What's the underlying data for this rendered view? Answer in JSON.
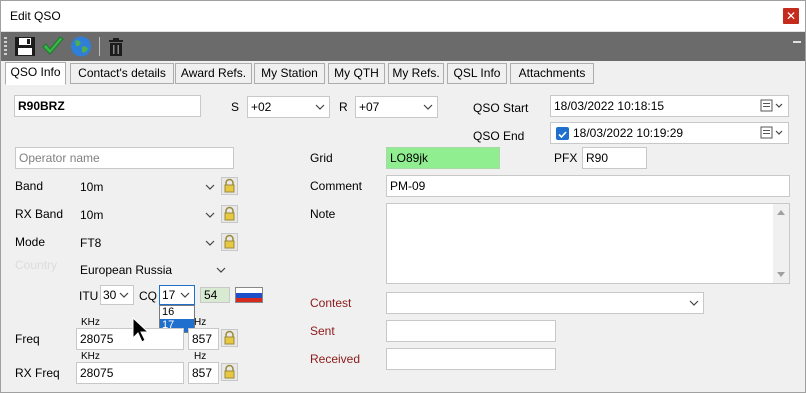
{
  "window": {
    "title": "Edit QSO"
  },
  "toolbar": {
    "icons": [
      "save-icon",
      "check-icon",
      "globe-icon",
      "trash-icon"
    ]
  },
  "tabs": [
    {
      "label": "QSO Info",
      "active": true
    },
    {
      "label": "Contact's details"
    },
    {
      "label": "Award Refs."
    },
    {
      "label": "My Station"
    },
    {
      "label": "My QTH"
    },
    {
      "label": "My Refs."
    },
    {
      "label": "QSL Info"
    },
    {
      "label": "Attachments"
    }
  ],
  "form": {
    "callsign": "R90BRZ",
    "s_label": "S",
    "s_value": "+02",
    "r_label": "R",
    "r_value": "+07",
    "qso_start_label": "QSO Start",
    "qso_start_value": "18/03/2022 10:18:15",
    "qso_end_label": "QSO End",
    "qso_end_value": "18/03/2022 10:19:29",
    "operator_placeholder": "Operator name",
    "band_label": "Band",
    "band_value": "10m",
    "rx_band_label": "RX Band",
    "rx_band_value": "10m",
    "mode_label": "Mode",
    "mode_value": "FT8",
    "country_label": "Country",
    "country_value": "European Russia",
    "itu_label": "ITU",
    "itu_value": "30",
    "cq_label": "CQ",
    "cq_value": "17",
    "cq_options": [
      "16",
      "17"
    ],
    "cq_selected": "17",
    "dxcc_value": "54",
    "freq_label": "Freq",
    "freq_unit_khz": "KHz",
    "freq_value": "28075",
    "freq_unit_hz": "Hz",
    "freq_hz": "857",
    "rx_freq_label": "RX Freq",
    "rx_freq_unit_khz": "KHz",
    "rx_freq_value": "28075",
    "rx_freq_unit_hz": "Hz",
    "rx_freq_hz": "857",
    "grid_label": "Grid",
    "grid_value": "LO89jk",
    "pfx_label": "PFX",
    "pfx_value": "R90",
    "comment_label": "Comment",
    "comment_value": "PM-09",
    "note_label": "Note",
    "note_value": "",
    "contest_label": "Contest",
    "contest_value": "",
    "sent_label": "Sent",
    "sent_value": "",
    "received_label": "Received",
    "received_value": ""
  },
  "colors": {
    "grid_bg": "#90ee90",
    "dxcc_bg": "#d9ead3",
    "selection": "#1f6fcf",
    "toolbar_bg": "#6b6b6b",
    "red_label": "#8b1a1a"
  }
}
